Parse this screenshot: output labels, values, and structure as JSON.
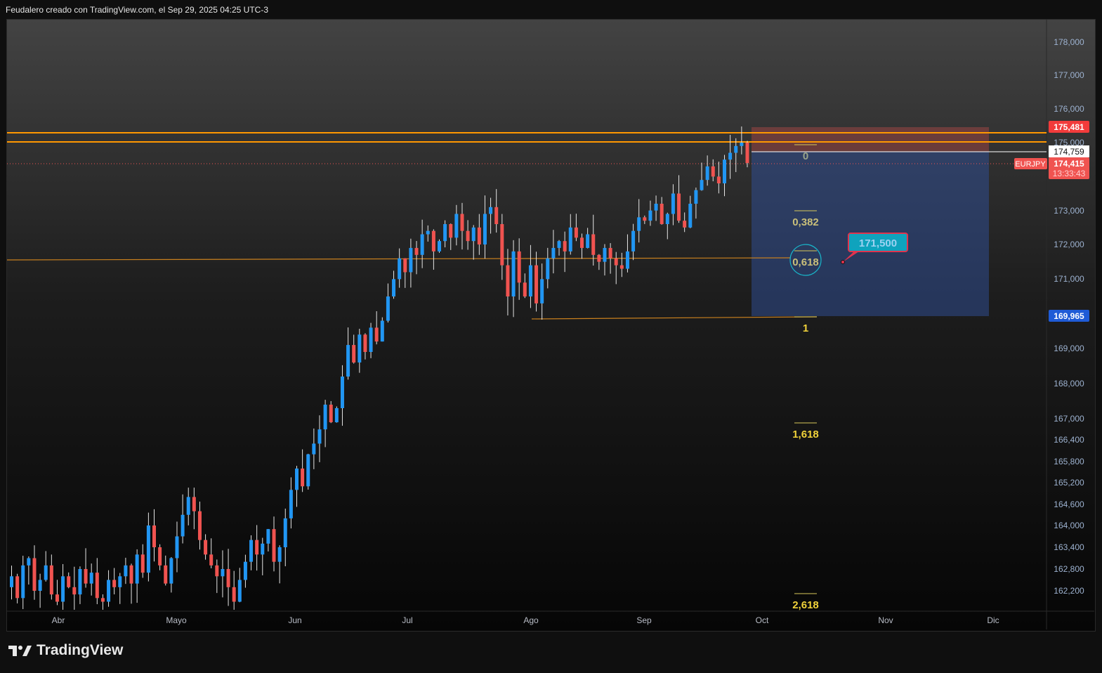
{
  "header": {
    "title": "Feudalero creado con TradingView.com, el Sep 29, 2025 04:25 UTC-3"
  },
  "symbol": "EURJPY",
  "price_axis": {
    "ticks": [
      "178,000",
      "177,000",
      "176,000",
      "175,000",
      "173,000",
      "172,000",
      "171,000",
      "169,000",
      "168,000",
      "167,000",
      "166,400",
      "165,800",
      "165,200",
      "164,600",
      "164,000",
      "163,400",
      "162,800",
      "162,200"
    ]
  },
  "price_labels": {
    "resistance": "175,481",
    "current_line": "174,759",
    "last_price": "174,415",
    "countdown": "13:33:43",
    "support": "169,965"
  },
  "time_axis": {
    "months": [
      "Abr",
      "Mayo",
      "Jun",
      "Jul",
      "Ago",
      "Sep",
      "Oct",
      "Nov",
      "Dic"
    ]
  },
  "fib_levels": [
    "0",
    "0,382",
    "0,618",
    "1",
    "1,618",
    "2,618"
  ],
  "target_callout": "171,500",
  "footer": {
    "brand": "TradingView"
  },
  "colors": {
    "up": "#2196f3",
    "down": "#f05350",
    "level": "#ff9800",
    "fib": "#d8c85a"
  },
  "candles": {
    "closes": [
      162.6,
      162.0,
      162.9,
      163.1,
      162.2,
      162.5,
      162.9,
      162.1,
      161.9,
      162.6,
      162.3,
      162.1,
      162.8,
      162.4,
      162.7,
      162.0,
      161.9,
      162.5,
      162.3,
      162.6,
      162.9,
      162.4,
      163.2,
      162.7,
      164.0,
      163.4,
      162.9,
      162.4,
      163.1,
      163.7,
      164.3,
      164.8,
      164.4,
      163.6,
      163.2,
      162.9,
      162.6,
      162.8,
      162.3,
      161.9,
      162.5,
      163.0,
      163.6,
      163.2,
      163.5,
      163.9,
      163.0,
      163.4,
      164.2,
      165.0,
      165.6,
      165.1,
      166.0,
      166.3,
      166.7,
      167.4,
      166.9,
      167.3,
      168.2,
      169.1,
      168.6,
      169.4,
      168.9,
      169.6,
      169.2,
      169.8,
      170.5,
      171.0,
      171.6,
      171.2,
      171.9,
      171.7,
      172.3,
      172.4,
      171.8,
      172.1,
      172.6,
      172.2,
      172.9,
      172.4,
      172.1,
      172.5,
      172.0,
      172.9,
      173.1,
      172.6,
      171.4,
      170.5,
      171.8,
      170.9,
      170.5,
      171.4,
      170.3,
      171.0,
      171.6,
      171.9,
      172.1,
      171.8,
      172.5,
      172.2,
      171.9,
      172.3,
      171.7,
      171.5,
      171.9,
      171.6,
      171.4,
      171.3,
      171.8,
      172.4,
      172.8,
      172.7,
      173.0,
      173.2,
      172.6,
      172.9,
      173.5,
      172.7,
      172.5,
      173.2,
      173.6,
      173.9,
      174.3,
      174.0,
      173.8,
      174.5,
      174.7,
      174.9,
      175.0,
      174.4
    ]
  }
}
